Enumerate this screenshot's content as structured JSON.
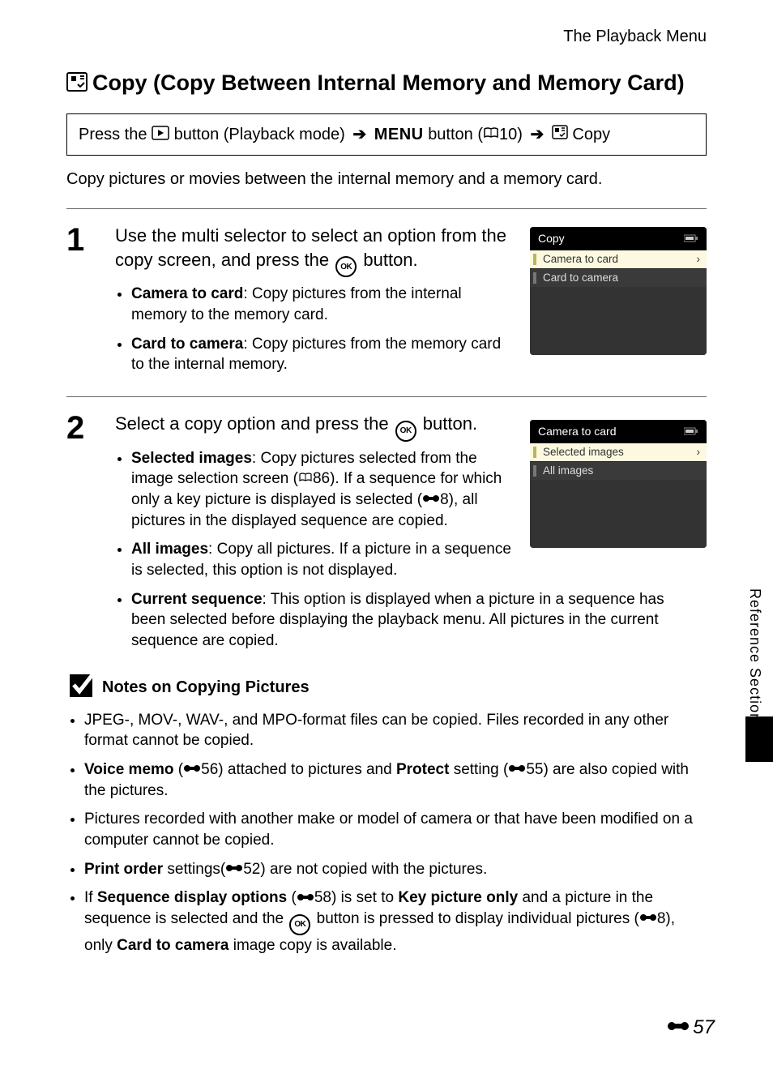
{
  "header": {
    "section": "The Playback Menu"
  },
  "title": "Copy (Copy Between Internal Memory and Memory Card)",
  "nav": {
    "press": "Press the",
    "playback_mode": "button (Playback mode)",
    "menu_button": "button (",
    "menu_ref": "10)",
    "copy": "Copy"
  },
  "intro": "Copy pictures or movies between the internal memory and a memory card.",
  "steps": [
    {
      "num": "1",
      "main_a": "Use the multi selector to select an option from the copy screen, and press the ",
      "main_b": " button.",
      "bullets": [
        {
          "label": "Camera to card",
          "text": ": Copy pictures from the internal memory to the memory card."
        },
        {
          "label": "Card to camera",
          "text": ": Copy pictures from the memory card to the internal memory."
        }
      ],
      "screen": {
        "title": "Copy",
        "rows": [
          "Camera to card",
          "Card to camera"
        ],
        "selected": 0
      }
    },
    {
      "num": "2",
      "main_a": "Select a copy option and press the ",
      "main_b": " button.",
      "bullets": [
        {
          "label": "Selected images",
          "text": ": Copy pictures selected from the image selection screen (",
          "ref": "86",
          "text2": "). If a sequence for which only a key picture is displayed is selected (",
          "eeref": "8",
          "text3": "), all pictures in the displayed sequence are copied."
        },
        {
          "label": "All images",
          "text": ": Copy all pictures. If a picture in a sequence is selected, this option is not displayed."
        },
        {
          "label": "Current sequence",
          "text": ": This option is displayed when a picture in a sequence has been selected before displaying the playback menu. All pictures in the current sequence are copied."
        }
      ],
      "screen": {
        "title": "Camera to card",
        "rows": [
          "Selected images",
          "All images"
        ],
        "selected": 0
      }
    }
  ],
  "notes": {
    "title": "Notes on Copying Pictures",
    "items": [
      {
        "text_a": "JPEG-, MOV-, WAV-, and MPO-format files can be copied. Files recorded in any other format cannot be copied."
      },
      {
        "bold_a": "Voice memo",
        "text_a": " (",
        "ee_a": "56",
        "text_b": ") attached to pictures and ",
        "bold_b": "Protect",
        "text_c": " setting (",
        "ee_b": "55",
        "text_d": ") are also copied with the pictures."
      },
      {
        "text_a": "Pictures recorded with another make or model of camera or that have been modified on a computer cannot be copied."
      },
      {
        "bold_a": "Print order",
        "text_a": " settings(",
        "ee_a": "52",
        "text_b": ") are not copied with the pictures."
      },
      {
        "text_a": "If ",
        "bold_a": "Sequence display options",
        "text_b": " (",
        "ee_a": "58",
        "text_c": ") is set to ",
        "bold_b": "Key picture only",
        "text_d": " and a picture in the sequence is selected and the ",
        "ok": true,
        "text_e": " button is pressed to display individual pictures (",
        "ee_b": "8",
        "text_f": "), only ",
        "bold_c": "Card to camera",
        "text_g": " image copy is available."
      }
    ]
  },
  "side": {
    "label": "Reference Section"
  },
  "page_number": "57"
}
